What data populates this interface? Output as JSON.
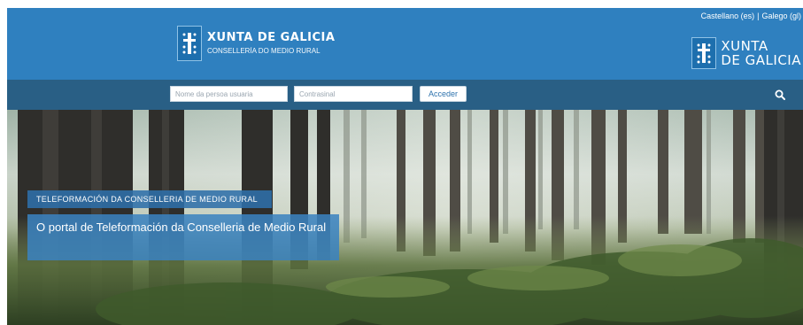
{
  "header": {
    "logo_title": "XUNTA DE GALICIA",
    "logo_subtitle": "CONSELLERÍA DO MEDIO RURAL",
    "right_logo_line1": "XUNTA",
    "right_logo_line2": "DE GALICIA"
  },
  "language": {
    "castellano": "Castellano (es)",
    "separator": "|",
    "galego": "Galego (gl)"
  },
  "login": {
    "username_placeholder": "Nome da persoa usuaria",
    "password_placeholder": "Contrasinal",
    "submit_label": "Acceder"
  },
  "hero": {
    "tag": "TELEFORMACIÓN DA CONSELLERIA DE MEDIO RURAL",
    "caption": "O portal de Teleformación da Conselleria de Medio Rural"
  },
  "colors": {
    "header_blue": "#2f80bf",
    "navbar_blue": "#295f85",
    "tag_blue": "#2f70aa"
  },
  "icons": {
    "search": "search-icon",
    "emblem": "xunta-emblem-icon"
  }
}
